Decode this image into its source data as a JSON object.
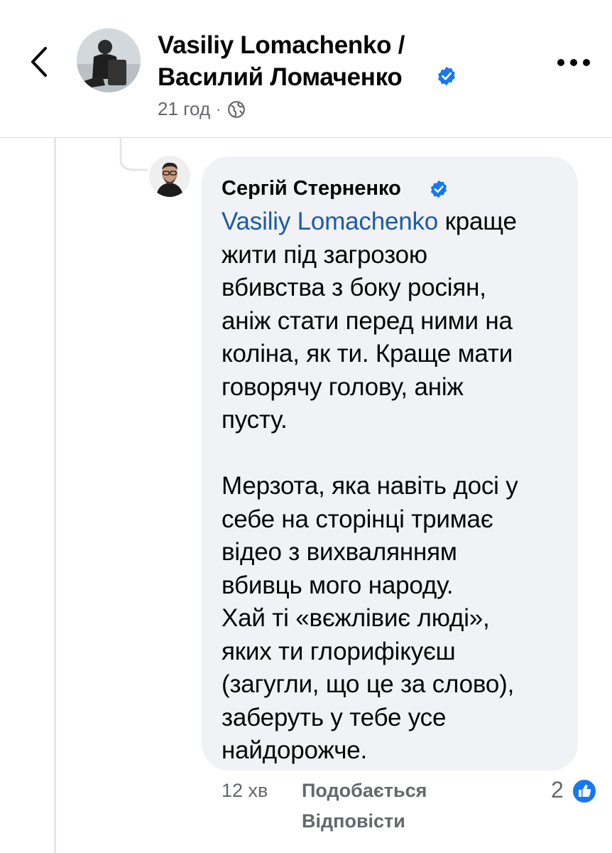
{
  "header": {
    "title_line1": "Vasiliy Lomachenko /",
    "title_line2": "Василий Ломаченко",
    "time": "21 год",
    "dot": "·",
    "icons": {
      "back": "chevron-left-icon",
      "verified": "verified-badge-icon",
      "audience": "globe-icon",
      "more": "more-horizontal-icon"
    }
  },
  "comment": {
    "author": "Сергій Стерненко",
    "mention": "Vasiliy Lomachenko",
    "lines": [
      " краще",
      "жити під загрозою",
      "вбивства з боку росіян,",
      "аніж стати перед ними на",
      "коліна, як ти. Краще мати",
      "говорячу голову, аніж",
      "пусту."
    ],
    "lines2": [
      "Мерзота, яка навіть досі у",
      "себе на сторінці тримає",
      "відео з вихвалянням",
      "вбивць мого народу.",
      "Хай ті «вєжлівиє люді»,",
      "яких ти глорифікуєш",
      "(загугли, що це за слово),",
      "заберуть у тебе усе",
      "найдорожче."
    ],
    "time": "12 хв",
    "like_label": "Подобається",
    "reply_label": "Відповісти",
    "reaction_count": "2",
    "reaction_icon": "like-reaction-icon"
  },
  "colors": {
    "verified": "#1877f2",
    "mention": "#1d5aa8",
    "secondary_text": "#65676b",
    "bubble": "#f0f2f5"
  }
}
